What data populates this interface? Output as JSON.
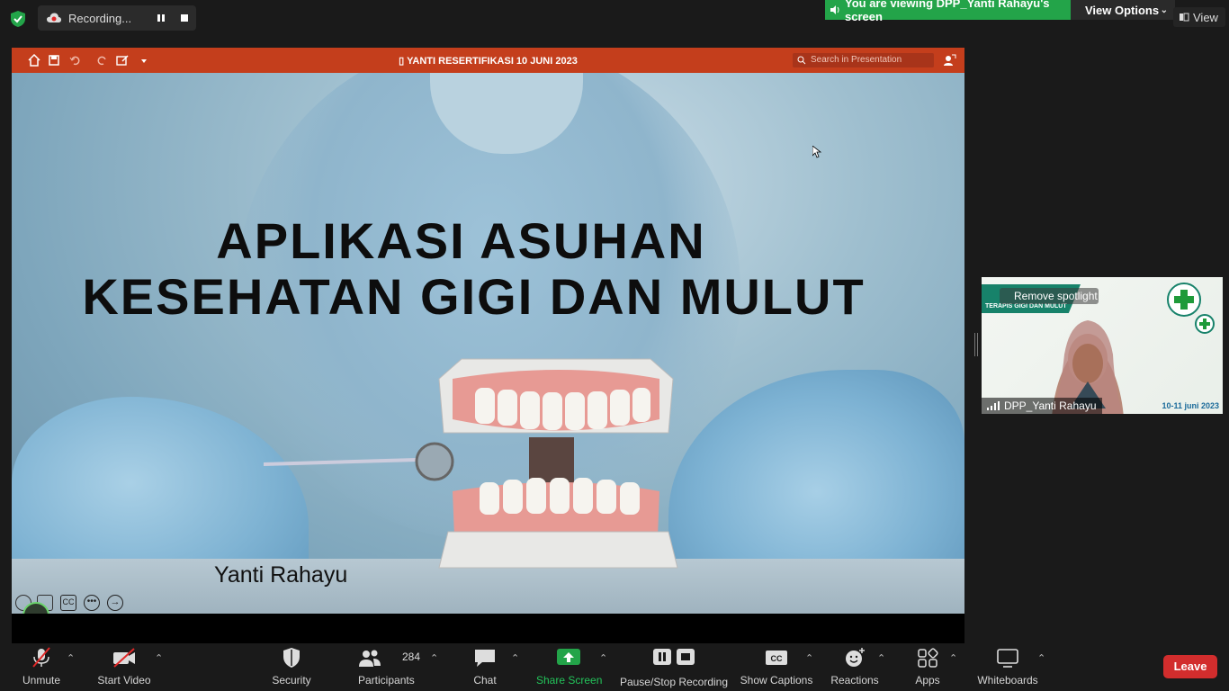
{
  "recording": {
    "label": "Recording..."
  },
  "banner": {
    "viewing": "You are viewing DPP_Yanti Rahayu's screen",
    "view_options": "View Options",
    "view": "View"
  },
  "presentation": {
    "title": "YANTI RESERTIFIKASI 10 JUNI 2023",
    "search_placeholder": "Search in Presentation",
    "slide_title_line1": "APLIKASI ASUHAN",
    "slide_title_line2": "KESEHATAN GIGI DAN MULUT",
    "slide_author": "Yanti Rahayu"
  },
  "participant": {
    "name": "DPP_Yanti Rahayu",
    "spotlight_label": "Remove spotlight",
    "banner_text": "TERAPIS GIGI DAN MULUT",
    "date_text": "10-11 juni 2023"
  },
  "toolbar": {
    "unmute": "Unmute",
    "start_video": "Start Video",
    "security": "Security",
    "participants": "Participants",
    "participants_count": "284",
    "chat": "Chat",
    "share_screen": "Share Screen",
    "pause_stop_recording": "Pause/Stop Recording",
    "show_captions": "Show Captions",
    "reactions": "Reactions",
    "apps": "Apps",
    "whiteboards": "Whiteboards",
    "leave": "Leave"
  },
  "colors": {
    "share_green": "#23a449",
    "ppt_orange": "#c43e1c",
    "leave_red": "#d22d2d"
  }
}
